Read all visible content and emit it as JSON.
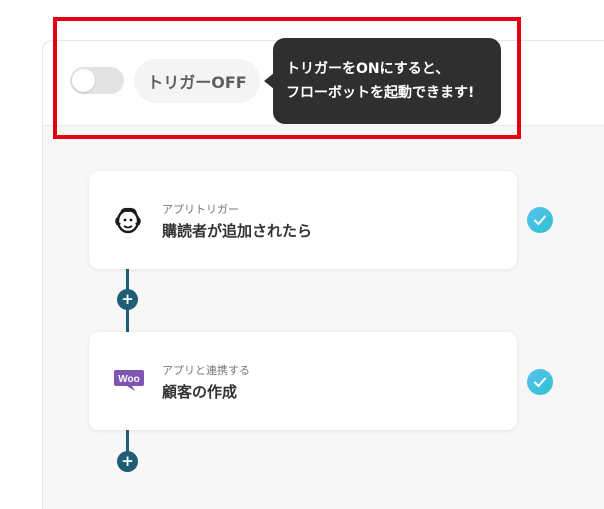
{
  "header": {
    "toggle_state": "off",
    "trigger_label": "トリガーOFF",
    "tooltip_line1": "トリガーをONにすると、",
    "tooltip_line2": "フローボットを起動できます!"
  },
  "steps": [
    {
      "subtitle": "アプリトリガー",
      "title": "購読者が追加されたら",
      "icon": "mailchimp-icon",
      "status": "completed"
    },
    {
      "subtitle": "アプリと連携する",
      "title": "顧客の作成",
      "icon": "woocommerce-icon",
      "icon_text": "Woo",
      "status": "completed"
    }
  ],
  "add_button_label": "+",
  "colors": {
    "highlight": "#e60012",
    "connector": "#1f5d74",
    "check": "#2bc3cf",
    "woo": "#7f54b3",
    "tooltip_bg": "#2f2f2f"
  }
}
